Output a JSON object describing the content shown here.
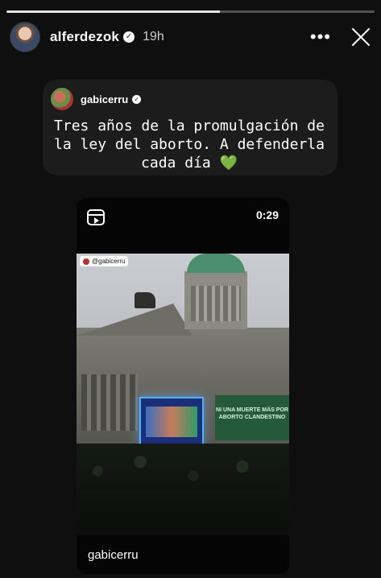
{
  "story": {
    "progress": 0.58
  },
  "header": {
    "username": "alferdezok",
    "timestamp": "19h",
    "more_label": "•••"
  },
  "shared_post": {
    "username": "gabicerru",
    "caption": "Tres años de la promulgación de la ley del aborto. A defenderla cada día",
    "emoji": "💚"
  },
  "reel": {
    "duration": "0:29",
    "overlay_username": "@gabicerru",
    "footer_username": "gabicerru",
    "banner_text": "NI UNA MUERTE MÁS POR ABORTO CLANDESTINO"
  },
  "colors": {
    "background": "#0f0f0f",
    "heart": "#2ecc40",
    "dome": "#4c8f6e",
    "banner": "#245a3a"
  }
}
